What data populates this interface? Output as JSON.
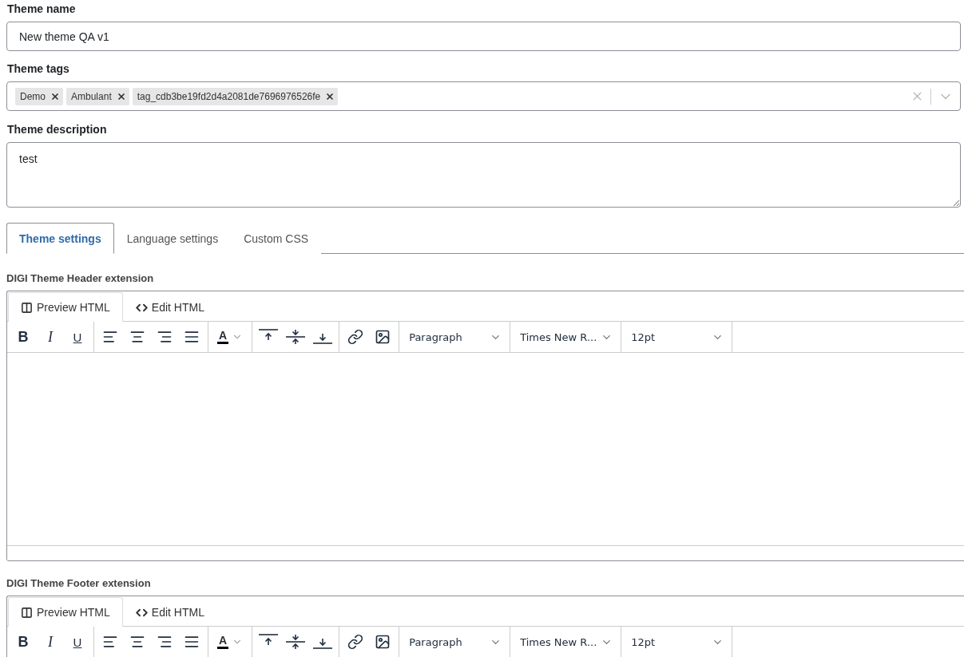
{
  "theme_name": {
    "label": "Theme name",
    "value": "New theme QA v1"
  },
  "theme_tags": {
    "label": "Theme tags",
    "tags": [
      {
        "text": "Demo"
      },
      {
        "text": "Ambulant"
      },
      {
        "text": "tag_cdb3be19fd2d4a2081de7696976526fe"
      }
    ]
  },
  "theme_description": {
    "label": "Theme description",
    "value": "test"
  },
  "tabs": [
    {
      "label": "Theme settings",
      "selected": true
    },
    {
      "label": "Language settings",
      "selected": false
    },
    {
      "label": "Custom CSS",
      "selected": false
    }
  ],
  "editors": [
    {
      "label": "DIGI Theme Header extension",
      "tabs": [
        {
          "label": "Preview HTML",
          "kind": "preview",
          "selected": true
        },
        {
          "label": "Edit HTML",
          "kind": "code",
          "selected": false
        }
      ],
      "toolbar": {
        "bold": "B",
        "italic": "I",
        "underline": "U",
        "text_color": "A",
        "block_format": "Paragraph",
        "font_family": "Times New R...",
        "font_size": "12pt"
      },
      "has_content_area": true
    },
    {
      "label": "DIGI Theme Footer extension",
      "tabs": [
        {
          "label": "Preview HTML",
          "kind": "preview",
          "selected": true
        },
        {
          "label": "Edit HTML",
          "kind": "code",
          "selected": false
        }
      ],
      "toolbar": {
        "bold": "B",
        "italic": "I",
        "underline": "U",
        "text_color": "A",
        "block_format": "Paragraph",
        "font_family": "Times New R...",
        "font_size": "12pt"
      },
      "has_content_area": false
    }
  ]
}
